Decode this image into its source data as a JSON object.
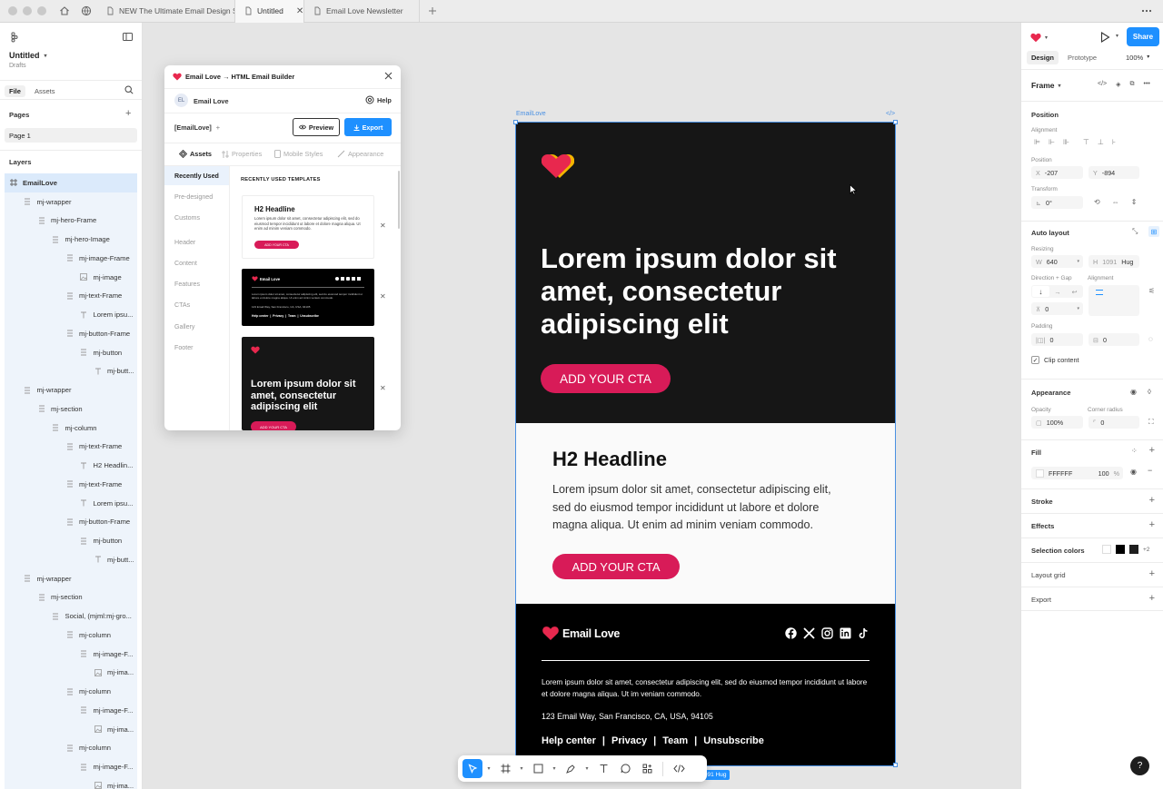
{
  "tabs": [
    {
      "label": "NEW The Ultimate Email Design Syste",
      "active": false
    },
    {
      "label": "Untitled",
      "active": true
    },
    {
      "label": "Email Love Newsletter",
      "active": false
    }
  ],
  "file": {
    "name": "Untitled",
    "location": "Drafts"
  },
  "left_tabs": {
    "file": "File",
    "assets": "Assets"
  },
  "pages": {
    "title": "Pages",
    "items": [
      "Page 1"
    ]
  },
  "layers": {
    "title": "Layers",
    "items": [
      {
        "label": "EmailLove",
        "depth": 0,
        "icon": "frame"
      },
      {
        "label": "mj-wrapper",
        "depth": 1,
        "icon": "autolayout"
      },
      {
        "label": "mj-hero-Frame",
        "depth": 2,
        "icon": "autolayout"
      },
      {
        "label": "mj-hero-Image",
        "depth": 3,
        "icon": "autolayout"
      },
      {
        "label": "mj-image-Frame",
        "depth": 4,
        "icon": "autolayout"
      },
      {
        "label": "mj-image",
        "depth": 5,
        "icon": "image"
      },
      {
        "label": "mj-text-Frame",
        "depth": 4,
        "icon": "autolayout"
      },
      {
        "label": "Lorem ipsu...",
        "depth": 5,
        "icon": "text"
      },
      {
        "label": "mj-button-Frame",
        "depth": 4,
        "icon": "autolayout"
      },
      {
        "label": "mj-button",
        "depth": 5,
        "icon": "autolayout"
      },
      {
        "label": "mj-butt...",
        "depth": 6,
        "icon": "text"
      },
      {
        "label": "mj-wrapper",
        "depth": 1,
        "icon": "autolayout"
      },
      {
        "label": "mj-section",
        "depth": 2,
        "icon": "autolayout"
      },
      {
        "label": "mj-column",
        "depth": 3,
        "icon": "autolayout"
      },
      {
        "label": "mj-text-Frame",
        "depth": 4,
        "icon": "autolayout"
      },
      {
        "label": "H2 Headlin...",
        "depth": 5,
        "icon": "text"
      },
      {
        "label": "mj-text-Frame",
        "depth": 4,
        "icon": "autolayout"
      },
      {
        "label": "Lorem ipsu...",
        "depth": 5,
        "icon": "text"
      },
      {
        "label": "mj-button-Frame",
        "depth": 4,
        "icon": "autolayout"
      },
      {
        "label": "mj-button",
        "depth": 5,
        "icon": "autolayout"
      },
      {
        "label": "mj-butt...",
        "depth": 6,
        "icon": "text"
      },
      {
        "label": "mj-wrapper",
        "depth": 1,
        "icon": "autolayout"
      },
      {
        "label": "mj-section",
        "depth": 2,
        "icon": "autolayout"
      },
      {
        "label": "Social, (mjml:mj-gro...",
        "depth": 3,
        "icon": "autolayout"
      },
      {
        "label": "mj-column",
        "depth": 4,
        "icon": "autolayout"
      },
      {
        "label": "mj-image-F...",
        "depth": 5,
        "icon": "autolayout"
      },
      {
        "label": "mj-ima...",
        "depth": 6,
        "icon": "image"
      },
      {
        "label": "mj-column",
        "depth": 4,
        "icon": "autolayout"
      },
      {
        "label": "mj-image-F...",
        "depth": 5,
        "icon": "autolayout"
      },
      {
        "label": "mj-ima...",
        "depth": 6,
        "icon": "image"
      },
      {
        "label": "mj-column",
        "depth": 4,
        "icon": "autolayout"
      },
      {
        "label": "mj-image-F...",
        "depth": 5,
        "icon": "autolayout"
      },
      {
        "label": "mj-ima...",
        "depth": 6,
        "icon": "image"
      }
    ]
  },
  "plugin": {
    "title": "Email Love → HTML Email Builder",
    "user": {
      "initials": "EL",
      "name": "Email Love"
    },
    "help": "Help",
    "project": "[EmailLove]",
    "preview": "Preview",
    "export": "Export",
    "tabs": [
      "Assets",
      "Properties",
      "Mobile Styles",
      "Appearance"
    ],
    "nav": [
      "Recently Used",
      "Pre-designed",
      "Customs",
      "Header",
      "Content",
      "Features",
      "CTAs",
      "Gallery",
      "Footer"
    ],
    "section_title": "RECENTLY USED TEMPLATES",
    "card1": {
      "headline": "H2 Headline",
      "body": "Lorem ipsum dolor sit amet, consectetur adipiscing elit, sed do eiusmod tempor incididunt ut labore et dolore magna aliqua. Ut enim ad minim veniam commodo.",
      "cta": "ADD YOUR CTA"
    },
    "card2": {
      "brand": "Email Love",
      "body": "Lorem ipsum dolor sit amet, consectetur adipiscing elit, sed do eiusmod tempor incididunt ut labore et dolore magna aliqua. Ut enim ad minim veniam commodo.",
      "address": "123 Email Way, San Francisco, CA, USA, 94105",
      "links": "Help center  |  Privacy  |  Team  |  Unsubscribe"
    },
    "card3": {
      "headline": "Lorem ipsum dolor sit amet, consectetur adipiscing elit",
      "cta": "ADD YOUR CTA"
    }
  },
  "canvas": {
    "frame_label": "EmailLove",
    "size_badge": "640 × 1091 Hug",
    "hero": {
      "headline": "Lorem ipsum dolor sit amet, consectetur adipiscing elit",
      "cta": "ADD YOUR CTA"
    },
    "content": {
      "headline": "H2 Headline",
      "body": "Lorem ipsum dolor sit amet, consectetur adipiscing elit, sed do eiusmod tempor incididunt ut labore et dolore magna aliqua. Ut enim ad minim veniam commodo.",
      "cta": "ADD YOUR CTA"
    },
    "footer": {
      "brand": "Email Love",
      "text": "Lorem ipsum dolor sit amet, consectetur adipiscing elit, sed do eiusmod tempor incididunt ut labore et dolore magna aliqua. Ut im veniam commodo.",
      "address": "123 Email Way, San Francisco, CA, USA, 94105",
      "links": [
        "Help center",
        "Privacy",
        "Team",
        "Unsubscribe"
      ],
      "separator": "|"
    }
  },
  "right": {
    "tabs": {
      "design": "Design",
      "prototype": "Prototype"
    },
    "zoom": "100%",
    "share": "Share",
    "frame_type": "Frame",
    "position": {
      "title": "Position",
      "alignment_label": "Alignment",
      "position_label": "Position",
      "x_key": "X",
      "x": "-207",
      "y_key": "Y",
      "y": "-894",
      "transform_label": "Transform",
      "rotation": "0°"
    },
    "auto_layout": {
      "title": "Auto layout",
      "resizing_label": "Resizing",
      "w_key": "W",
      "w": "640",
      "h_key": "H",
      "h": "1091",
      "h_mode": "Hug",
      "direction_label": "Direction + Gap",
      "alignment_label": "Alignment",
      "gap": "0",
      "padding_label": "Padding",
      "padding_h": "0",
      "padding_v": "0",
      "clip": "Clip content"
    },
    "appearance": {
      "title": "Appearance",
      "opacity_label": "Opacity",
      "opacity": "100%",
      "radius_label": "Corner radius",
      "radius": "0"
    },
    "fill": {
      "title": "Fill",
      "hex": "FFFFFF",
      "opacity": "100",
      "unit": "%"
    },
    "stroke": "Stroke",
    "effects": "Effects",
    "selection_colors": {
      "title": "Selection colors",
      "more": "+2"
    },
    "layout_grid": "Layout grid",
    "export": "Export",
    "help": "?"
  },
  "colors": {
    "accent": "#1e90ff",
    "cta": "#d81b58",
    "hero_bg": "#161616",
    "footer_bg": "#000000",
    "heart": "#e8284e",
    "heart_secondary": "#f4b400"
  }
}
